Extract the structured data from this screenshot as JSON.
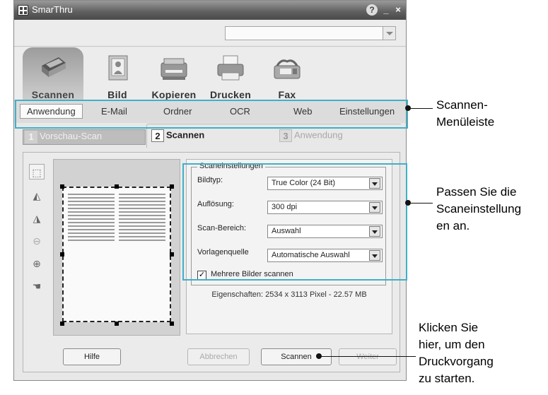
{
  "window": {
    "title": "SmarThru",
    "help_label": "?",
    "minimize_label": "_",
    "close_label": "×"
  },
  "topbar": {
    "combo_value": ""
  },
  "toolbar": {
    "items": [
      {
        "label": "Scannen",
        "icon": "scanner-icon",
        "active": true
      },
      {
        "label": "Bild",
        "icon": "image-icon",
        "active": false
      },
      {
        "label": "Kopieren",
        "icon": "copier-icon",
        "active": false
      },
      {
        "label": "Drucken",
        "icon": "printer-icon",
        "active": false
      },
      {
        "label": "Fax",
        "icon": "fax-icon",
        "active": false
      }
    ]
  },
  "menubar": {
    "items": [
      {
        "label": "Anwendung",
        "selected": true
      },
      {
        "label": "E-Mail",
        "selected": false
      },
      {
        "label": "Ordner",
        "selected": false
      },
      {
        "label": "OCR",
        "selected": false
      },
      {
        "label": "Web",
        "selected": false
      },
      {
        "label": "Einstellungen",
        "selected": false
      }
    ]
  },
  "steps": [
    {
      "num": "1",
      "label": "Vorschau-Scan"
    },
    {
      "num": "2",
      "label": "Scannen"
    },
    {
      "num": "3",
      "label": "Anwendung"
    }
  ],
  "side_tools": [
    "select-area-icon",
    "flip-horizontal-icon",
    "flip-vertical-icon",
    "zoom-out-icon",
    "zoom-in-icon",
    "pan-hand-icon"
  ],
  "settings": {
    "legend": "Scaneinstellungen",
    "fields": [
      {
        "label": "Bildtyp:",
        "value": "True Color (24 Bit)"
      },
      {
        "label": "Auflösung:",
        "value": "300 dpi"
      },
      {
        "label": "Scan-Bereich:",
        "value": "Auswahl"
      },
      {
        "label": "Vorlagenquelle",
        "value": "Automatische Auswahl"
      }
    ],
    "multi_checkbox_label": "Mehrere Bilder scannen",
    "multi_checked": true,
    "properties": "Eigenschaften: 2534 x 3113 Pixel - 22.57 MB"
  },
  "buttons": {
    "help": "Hilfe",
    "cancel": "Abbrechen",
    "scan": "Scannen",
    "next": "Weiter"
  },
  "callouts": {
    "menu": "Scannen-\nMenüleiste",
    "settings": "Passen Sie die\nScaneinstellung\nen an.",
    "scan": "Klicken Sie\nhier, um den\nDruckvorgang\nzu starten."
  },
  "colors": {
    "callout_outline": "#3fb0c9",
    "titlebar": "#5e5e5e"
  }
}
